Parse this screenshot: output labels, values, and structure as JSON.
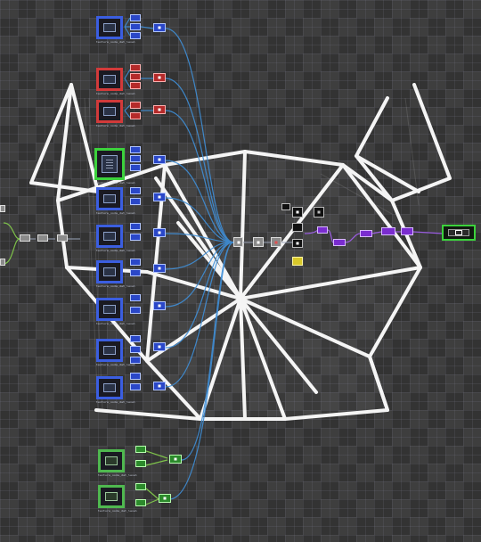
{
  "app": "node network editor",
  "colors": {
    "canvas": "#3e3e3e",
    "wire": "#3f8fd8",
    "wire_green": "#7ec24a",
    "wire_purple": "#9a5ce0",
    "texture_blue": "#2a47c8",
    "texture_red": "#c83a3a",
    "texture_green": "#4fb84f",
    "selected": "#3cd23c",
    "shape_stroke": "#ffffff"
  },
  "icons": [
    "texture-thumbnail-icon",
    "display-output-icon",
    "chip-icon"
  ],
  "caption": "texture_node_dat_level"
}
